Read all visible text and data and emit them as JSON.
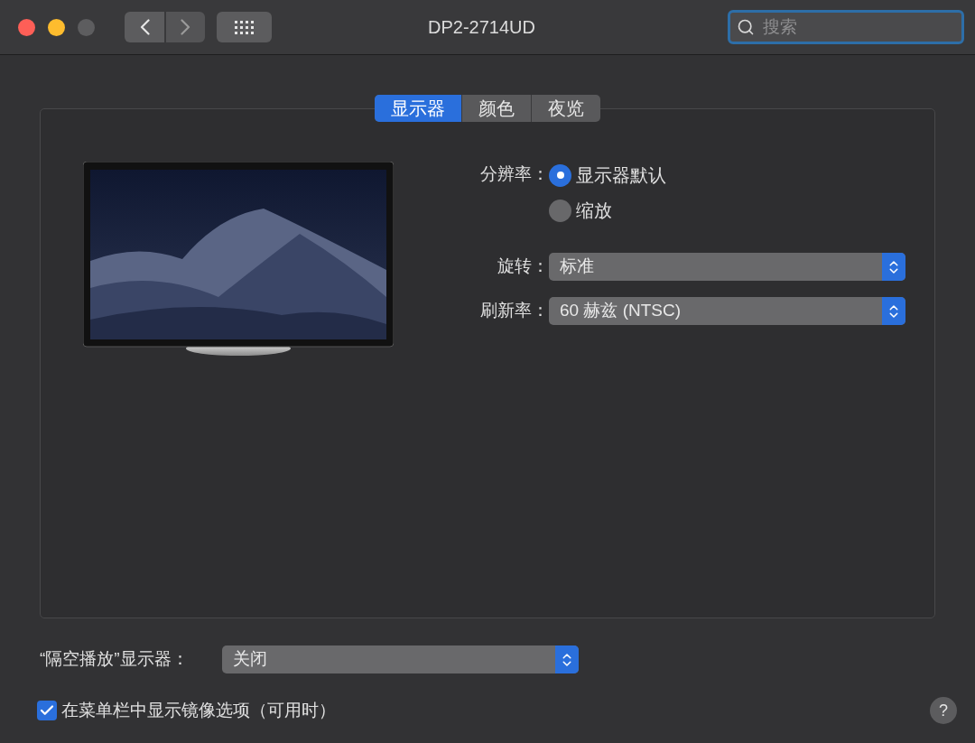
{
  "window": {
    "title": "DP2-2714UD"
  },
  "search": {
    "placeholder": "搜索"
  },
  "tabs": [
    {
      "label": "显示器",
      "selected": true
    },
    {
      "label": "颜色",
      "selected": false
    },
    {
      "label": "夜览",
      "selected": false
    }
  ],
  "resolution": {
    "label": "分辨率：",
    "options": [
      {
        "label": "显示器默认",
        "selected": true
      },
      {
        "label": "缩放",
        "selected": false
      }
    ]
  },
  "popups": [
    {
      "label": "旋转：",
      "value": "标准"
    },
    {
      "label": "刷新率：",
      "value": "60 赫兹 (NTSC)"
    }
  ],
  "airplay": {
    "label": "“隔空播放”显示器：",
    "value": "关闭"
  },
  "mirror_option": {
    "label": "在菜单栏中显示镜像选项（可用时）",
    "checked": true
  },
  "help": {
    "label": "?"
  }
}
